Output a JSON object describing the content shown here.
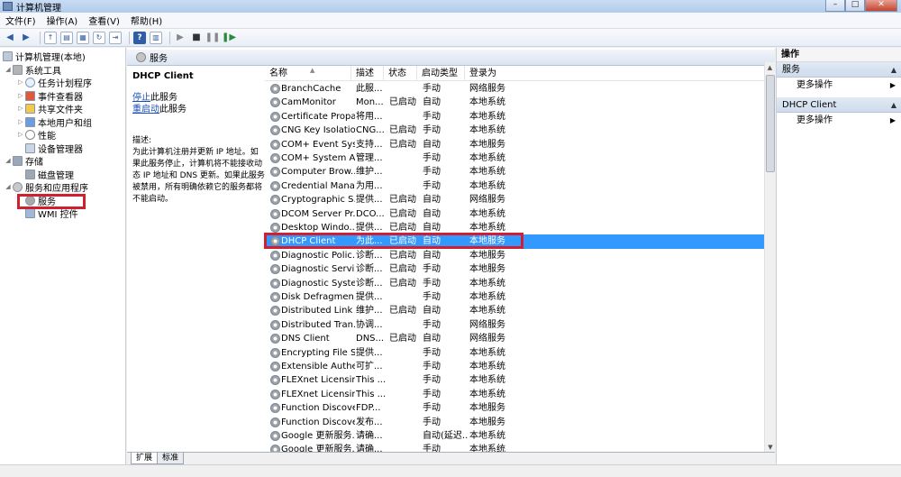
{
  "window": {
    "title": "计算机管理"
  },
  "window_buttons": {
    "minimize": "–",
    "maximize": "□",
    "close": "✕"
  },
  "menu": [
    "文件(F)",
    "操作(A)",
    "查看(V)",
    "帮助(H)"
  ],
  "tree": {
    "root": "计算机管理(本地)",
    "nodes": [
      {
        "label": "系统工具",
        "icon": "tools-icon"
      },
      {
        "label": "任务计划程序",
        "icon": "clock-icon"
      },
      {
        "label": "事件查看器",
        "icon": "event-viewer-icon"
      },
      {
        "label": "共享文件夹",
        "icon": "shared-folder-icon"
      },
      {
        "label": "本地用户和组",
        "icon": "users-icon"
      },
      {
        "label": "性能",
        "icon": "performance-icon"
      },
      {
        "label": "设备管理器",
        "icon": "device-manager-icon"
      },
      {
        "label": "存储",
        "icon": "storage-icon"
      },
      {
        "label": "磁盘管理",
        "icon": "disk-icon"
      },
      {
        "label": "服务和应用程序",
        "icon": "services-apps-icon"
      },
      {
        "label": "服务",
        "icon": "gear-icon"
      },
      {
        "label": "WMI 控件",
        "icon": "wmi-icon"
      }
    ]
  },
  "services_header": "服务",
  "detail": {
    "name": "DHCP Client",
    "stop_link": "停止",
    "stop_suffix": "此服务",
    "restart_link": "重启动",
    "restart_suffix": "此服务",
    "desc_label": "描述:",
    "desc_text": "为此计算机注册并更新 IP 地址。如果此服务停止，计算机将不能接收动态 IP 地址和 DNS 更新。如果此服务被禁用，所有明确依赖它的服务都将不能启动。"
  },
  "columns": [
    "名称",
    "描述",
    "状态",
    "启动类型",
    "登录为"
  ],
  "rows": [
    {
      "name": "BranchCache",
      "desc": "此服...",
      "status": "",
      "startup": "手动",
      "logon": "网络服务"
    },
    {
      "name": "CamMonitor",
      "desc": "Mon...",
      "status": "已启动",
      "startup": "自动",
      "logon": "本地系统"
    },
    {
      "name": "Certificate Propa...",
      "desc": "将用...",
      "status": "",
      "startup": "手动",
      "logon": "本地系统"
    },
    {
      "name": "CNG Key Isolation",
      "desc": "CNG...",
      "status": "已启动",
      "startup": "手动",
      "logon": "本地系统"
    },
    {
      "name": "COM+ Event Sys...",
      "desc": "支持...",
      "status": "已启动",
      "startup": "自动",
      "logon": "本地服务"
    },
    {
      "name": "COM+ System A...",
      "desc": "管理...",
      "status": "",
      "startup": "手动",
      "logon": "本地系统"
    },
    {
      "name": "Computer Brow...",
      "desc": "维护...",
      "status": "",
      "startup": "手动",
      "logon": "本地系统"
    },
    {
      "name": "Credential Mana...",
      "desc": "为用...",
      "status": "",
      "startup": "手动",
      "logon": "本地系统"
    },
    {
      "name": "Cryptographic S...",
      "desc": "提供...",
      "status": "已启动",
      "startup": "自动",
      "logon": "网络服务"
    },
    {
      "name": "DCOM Server Pr...",
      "desc": "DCO...",
      "status": "已启动",
      "startup": "自动",
      "logon": "本地系统"
    },
    {
      "name": "Desktop Windo...",
      "desc": "提供...",
      "status": "已启动",
      "startup": "自动",
      "logon": "本地系统"
    },
    {
      "name": "DHCP Client",
      "desc": "为此...",
      "status": "已启动",
      "startup": "自动",
      "logon": "本地服务",
      "selected": true
    },
    {
      "name": "Diagnostic Polic...",
      "desc": "诊断...",
      "status": "已启动",
      "startup": "自动",
      "logon": "本地服务"
    },
    {
      "name": "Diagnostic Servi...",
      "desc": "诊断...",
      "status": "已启动",
      "startup": "手动",
      "logon": "本地服务"
    },
    {
      "name": "Diagnostic Syste...",
      "desc": "诊断...",
      "status": "已启动",
      "startup": "手动",
      "logon": "本地系统"
    },
    {
      "name": "Disk Defragmen...",
      "desc": "提供...",
      "status": "",
      "startup": "手动",
      "logon": "本地系统"
    },
    {
      "name": "Distributed Link ...",
      "desc": "维护...",
      "status": "已启动",
      "startup": "自动",
      "logon": "本地系统"
    },
    {
      "name": "Distributed Tran...",
      "desc": "协调...",
      "status": "",
      "startup": "手动",
      "logon": "网络服务"
    },
    {
      "name": "DNS Client",
      "desc": "DNS...",
      "status": "已启动",
      "startup": "自动",
      "logon": "网络服务"
    },
    {
      "name": "Encrypting File S...",
      "desc": "提供...",
      "status": "",
      "startup": "手动",
      "logon": "本地系统"
    },
    {
      "name": "Extensible Authe...",
      "desc": "可扩...",
      "status": "",
      "startup": "手动",
      "logon": "本地系统"
    },
    {
      "name": "FLEXnet Licensin...",
      "desc": "This ...",
      "status": "",
      "startup": "手动",
      "logon": "本地系统"
    },
    {
      "name": "FLEXnet Licensin...",
      "desc": "This ...",
      "status": "",
      "startup": "手动",
      "logon": "本地系统"
    },
    {
      "name": "Function Discove...",
      "desc": "FDP...",
      "status": "",
      "startup": "手动",
      "logon": "本地服务"
    },
    {
      "name": "Function Discove...",
      "desc": "发布...",
      "status": "",
      "startup": "手动",
      "logon": "本地服务"
    },
    {
      "name": "Google 更新服务...",
      "desc": "请确...",
      "status": "",
      "startup": "自动(延迟...",
      "logon": "本地系统"
    },
    {
      "name": "Google 更新服务...",
      "desc": "请确...",
      "status": "",
      "startup": "手动",
      "logon": "本地系统"
    }
  ],
  "tabs": [
    "扩展",
    "标准"
  ],
  "actions": {
    "header": "操作",
    "section1": "服务",
    "more1": "更多操作",
    "section2": "DHCP Client",
    "more2": "更多操作"
  },
  "colors": {
    "selection": "#3399ff",
    "highlight_box": "#d02030",
    "link": "#1a4fb3"
  }
}
